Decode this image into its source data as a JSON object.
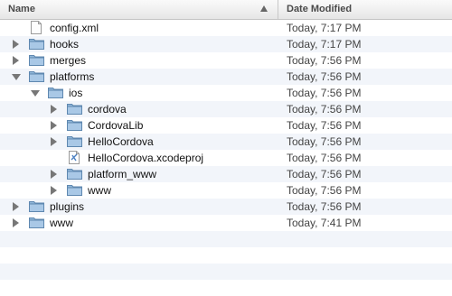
{
  "header": {
    "name_label": "Name",
    "date_label": "Date Modified"
  },
  "rows": [
    {
      "name": "config.xml",
      "date": "Today, 7:17 PM",
      "icon": "xml-file-icon",
      "depth": 0,
      "expand": "none"
    },
    {
      "name": "hooks",
      "date": "Today, 7:17 PM",
      "icon": "folder-icon",
      "depth": 0,
      "expand": "closed"
    },
    {
      "name": "merges",
      "date": "Today, 7:56 PM",
      "icon": "folder-icon",
      "depth": 0,
      "expand": "closed"
    },
    {
      "name": "platforms",
      "date": "Today, 7:56 PM",
      "icon": "folder-icon",
      "depth": 0,
      "expand": "open"
    },
    {
      "name": "ios",
      "date": "Today, 7:56 PM",
      "icon": "folder-icon",
      "depth": 1,
      "expand": "open"
    },
    {
      "name": "cordova",
      "date": "Today, 7:56 PM",
      "icon": "folder-icon",
      "depth": 2,
      "expand": "closed"
    },
    {
      "name": "CordovaLib",
      "date": "Today, 7:56 PM",
      "icon": "folder-icon",
      "depth": 2,
      "expand": "closed"
    },
    {
      "name": "HelloCordova",
      "date": "Today, 7:56 PM",
      "icon": "folder-icon",
      "depth": 2,
      "expand": "closed"
    },
    {
      "name": "HelloCordova.xcodeproj",
      "date": "Today, 7:56 PM",
      "icon": "xcodeproj-file-icon",
      "depth": 2,
      "expand": "none"
    },
    {
      "name": "platform_www",
      "date": "Today, 7:56 PM",
      "icon": "folder-icon",
      "depth": 2,
      "expand": "closed"
    },
    {
      "name": "www",
      "date": "Today, 7:56 PM",
      "icon": "folder-icon",
      "depth": 2,
      "expand": "closed"
    },
    {
      "name": "plugins",
      "date": "Today, 7:56 PM",
      "icon": "folder-icon",
      "depth": 0,
      "expand": "closed"
    },
    {
      "name": "www",
      "date": "Today, 7:41 PM",
      "icon": "folder-icon",
      "depth": 0,
      "expand": "closed"
    }
  ],
  "empty_rows": 4,
  "colors": {
    "folder": "#8fb6d9",
    "stripe": "#f2f5fa"
  }
}
